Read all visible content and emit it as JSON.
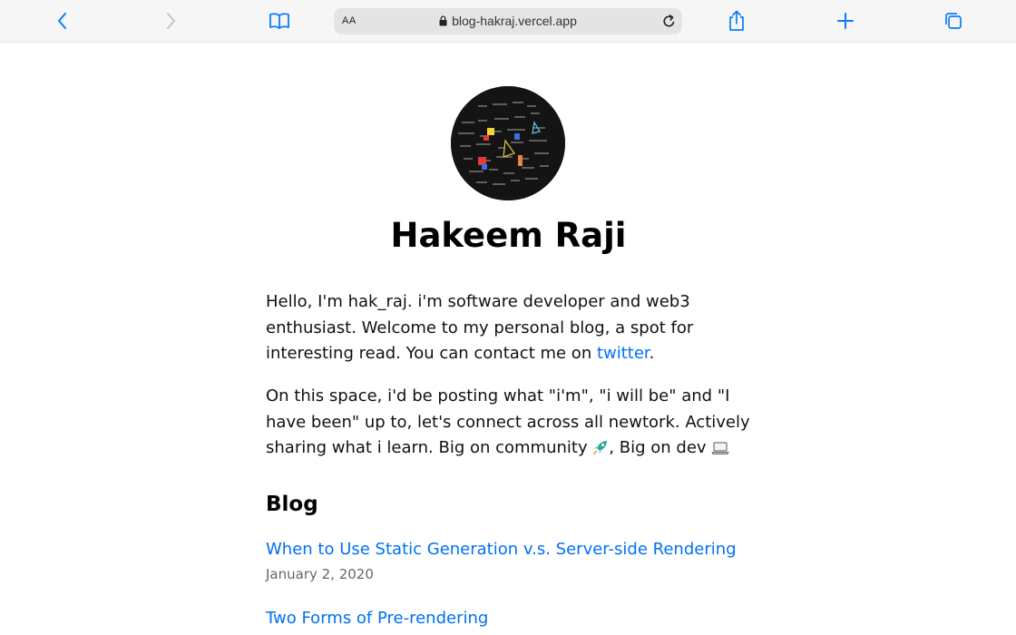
{
  "browser": {
    "reader_label": "AA",
    "url": "blog-hakraj.vercel.app",
    "accent": "#0a7cf5",
    "icons": {
      "back": "chevron-left-icon",
      "forward": "chevron-right-icon",
      "bookmarks": "book-icon",
      "lock": "lock-icon",
      "reload": "reload-icon",
      "share": "share-icon",
      "new_tab": "plus-icon",
      "tabs": "tabs-icon"
    }
  },
  "profile": {
    "name": "Hakeem Raji"
  },
  "intro": {
    "p1_text": "Hello, I'm hak_raj. i'm software developer and web3 enthusiast. Welcome to my personal blog, a spot for interesting read. You can contact me on ",
    "p1_link": "twitter",
    "p1_end": ".",
    "p2_text": "On this space, i'd be posting what \"i'm\", \"i will be\" and \"I have been\" up to, let's connect across all newtork. Actively sharing what i learn. Big on community ",
    "p2_mid": ", Big on dev "
  },
  "blog": {
    "heading": "Blog",
    "posts": [
      {
        "title": "When to Use Static Generation v.s. Server-side Rendering",
        "date": "January 2, 2020"
      },
      {
        "title": "Two Forms of Pre-rendering",
        "date": ""
      }
    ],
    "link_color": "#0070f3"
  }
}
